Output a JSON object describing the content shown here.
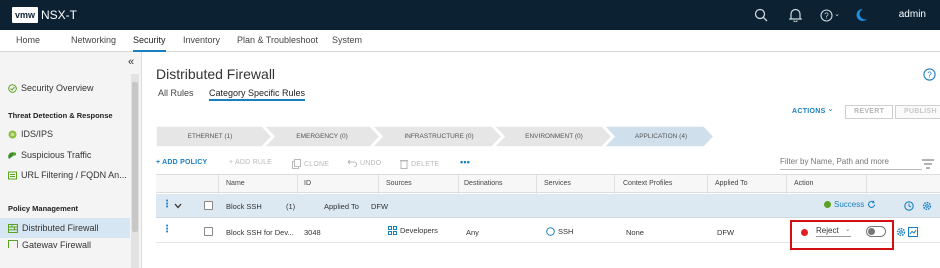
{
  "header": {
    "logo": "vmw",
    "product": "NSX-T",
    "user": "admin",
    "icons": [
      "search-icon",
      "bell-icon",
      "help-menu-icon",
      "moon-icon"
    ],
    "help_caret": "⌄"
  },
  "nav": {
    "tabs": [
      {
        "label": "Home"
      },
      {
        "label": "Networking"
      },
      {
        "label": "Security",
        "active": true
      },
      {
        "label": "Inventory"
      },
      {
        "label": "Plan & Troubleshoot"
      },
      {
        "label": "System"
      }
    ]
  },
  "sidebar": {
    "collapse": "«",
    "items": [
      {
        "label": "Security Overview",
        "icon": "overview-icon"
      },
      {
        "label": "IDS/IPS",
        "icon": "ids-icon"
      },
      {
        "label": "Suspicious Traffic",
        "icon": "suspicious-traffic-icon"
      },
      {
        "label": "URL Filtering / FQDN An...",
        "icon": "url-filter-icon"
      },
      {
        "label": "Distributed Firewall",
        "icon": "firewall-icon",
        "active": true
      },
      {
        "label": "Gateway Firewall",
        "icon": "gateway-icon"
      }
    ],
    "sections": {
      "threat": "Threat Detection & Response",
      "policy": "Policy Management"
    }
  },
  "main": {
    "title": "Distributed Firewall",
    "subtabs": [
      {
        "label": "All Rules"
      },
      {
        "label": "Category Specific Rules",
        "active": true
      }
    ],
    "actions": {
      "actions_label": "ACTIONS",
      "caret": "⌄",
      "revert": "REVERT",
      "publish": "PUBLISH"
    },
    "categories": [
      {
        "label": "ETHERNET (1)"
      },
      {
        "label": "EMERGENCY (0)"
      },
      {
        "label": "INFRASTRUCTURE (0)"
      },
      {
        "label": "ENVIRONMENT (0)"
      },
      {
        "label": "APPLICATION (4)",
        "active": true
      }
    ],
    "toolbar": {
      "add_policy": "+ ADD POLICY",
      "add_rule": "+ ADD RULE",
      "clone": "CLONE",
      "undo": "UNDO",
      "delete": "DELETE",
      "more": "•••"
    },
    "filter_placeholder": "Filter by Name, Path and more",
    "columns": [
      "Name",
      "ID",
      "Sources",
      "Destinations",
      "Services",
      "Context Profiles",
      "Applied To",
      "Action"
    ],
    "policy_row": {
      "name": "Block SSH",
      "count": "(1)",
      "applied_to_label": "Applied To",
      "applied_to": "DFW",
      "status": "Success",
      "status_color": "#5aa220"
    },
    "rule_row": {
      "name": "Block SSH for Dev...",
      "id": "3048",
      "sources": "Developers",
      "destinations": "Any",
      "services": "SSH",
      "context_profiles": "None",
      "applied_to": "DFW",
      "action": "Reject",
      "caret": "⌄",
      "action_color": "#e02020",
      "enabled": false
    }
  },
  "colors": {
    "header_bg": "#0c2233",
    "accent": "#1a7fc0",
    "highlight_box": "#d20f12"
  }
}
